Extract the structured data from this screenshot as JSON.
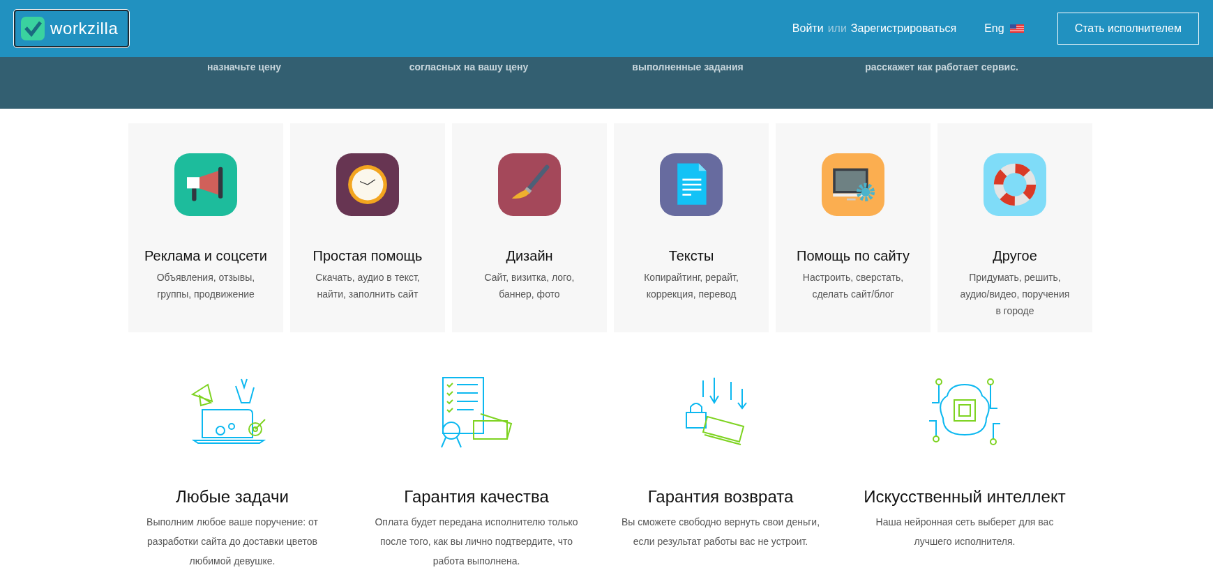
{
  "header": {
    "logo": "workzilla",
    "login": "Войти",
    "or": "или",
    "register": "Зарегистрироваться",
    "language": "Eng",
    "cta": "Стать исполнителем"
  },
  "band": [
    "назначьте цену",
    "согласных на вашу цену",
    "выполненные задания",
    "расскажет как работает сервис."
  ],
  "categories": [
    {
      "kind": "megaphone",
      "color": "#1dbc9c",
      "title": "Реклама и соцсети",
      "lines": [
        "Объявления, отзывы,",
        "группы, продвижение"
      ]
    },
    {
      "kind": "clock",
      "color": "#673552",
      "title": "Простая помощь",
      "lines": [
        "Скачать, аудио в текст,",
        "найти, заполнить сайт"
      ]
    },
    {
      "kind": "brush",
      "color": "#a4485a",
      "title": "Дизайн",
      "lines": [
        "Сайт, визитка, лого,",
        "баннер, фото"
      ]
    },
    {
      "kind": "document",
      "color": "#676b9f",
      "title": "Тексты",
      "lines": [
        "Копирайтинг, рерайт,",
        "коррекция, перевод"
      ]
    },
    {
      "kind": "monitor",
      "color": "#fbae50",
      "title": "Помощь по сайту",
      "lines": [
        "Настроить, сверстать,",
        "сделать сайт/блог"
      ]
    },
    {
      "kind": "lifebuoy",
      "color": "#7fdcf8",
      "title": "Другое",
      "lines": [
        "Придумать, решить,",
        "аудио/видео, поручения",
        "в городе"
      ]
    }
  ],
  "features": [
    {
      "kind": "tasks",
      "title": "Любые задачи",
      "lines": [
        "Выполним любое ваше поручение: от",
        "разработки сайта до доставки цветов",
        "любимой девушке."
      ]
    },
    {
      "kind": "quality",
      "title": "Гарантия качества",
      "lines": [
        "Оплата будет передана исполнителю только",
        "после того, как вы лично подтвердите, что",
        "работа выполнена."
      ]
    },
    {
      "kind": "refund",
      "title": "Гарантия возврата",
      "lines": [
        "Вы сможете свободно вернуть свои деньги,",
        "если результат работы вас не устроит."
      ]
    },
    {
      "kind": "ai",
      "title": "Искусственный интеллект",
      "lines": [
        "Наша нейронная сеть выберет для вас",
        "лучшего исполнителя."
      ]
    }
  ]
}
